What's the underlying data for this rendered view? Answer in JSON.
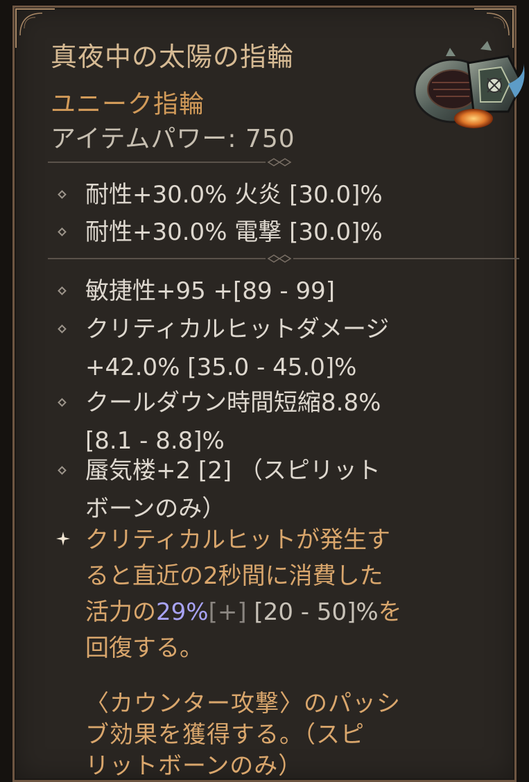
{
  "item": {
    "name": "真夜中の太陽の指輪",
    "type": "ユニーク指輪",
    "item_power": "アイテムパワー: 750"
  },
  "implicit_affixes": [
    {
      "text": "耐性+30.0% 火炎 [30.0]%"
    },
    {
      "text": "耐性+30.0% 電撃 [30.0]%"
    }
  ],
  "affixes": [
    {
      "line1": "敏捷性+95 +[89 - 99]",
      "line2": ""
    },
    {
      "line1": "クリティカルヒットダメージ",
      "line2": "+42.0% [35.0 - 45.0]%"
    },
    {
      "line1": "クールダウン時間短縮8.8%",
      "line2": "[8.1 - 8.8]%"
    },
    {
      "line1": "蜃気楼+2 [2] （スピリット",
      "line2": "ボーンのみ）"
    }
  ],
  "unique_power": {
    "line1": "クリティカルヒットが発生す",
    "line2": "ると直近の2秒間に消費した",
    "line3_prefix": "活力の",
    "value": "29%",
    "upgrade": "[+]",
    "range": " [20 - 50]%",
    "line3_suffix": "を",
    "line4": "回復する。"
  },
  "passive": {
    "line1": "〈カウンター攻撃〉のパッシ",
    "line2": "ブ効果を獲得する。（スピ",
    "line3": "リットボーンのみ）"
  },
  "colors": {
    "title": "#d6ba93",
    "unique": "#d19a59",
    "text": "#ded8cf",
    "value_highlight": "#a8a3f5",
    "background": "#2a2622",
    "border": "#6e5642"
  },
  "icons": {
    "item": "ring-icon",
    "bullet": "diamond-bullet-icon",
    "unique_bullet": "star-bullet-icon"
  }
}
